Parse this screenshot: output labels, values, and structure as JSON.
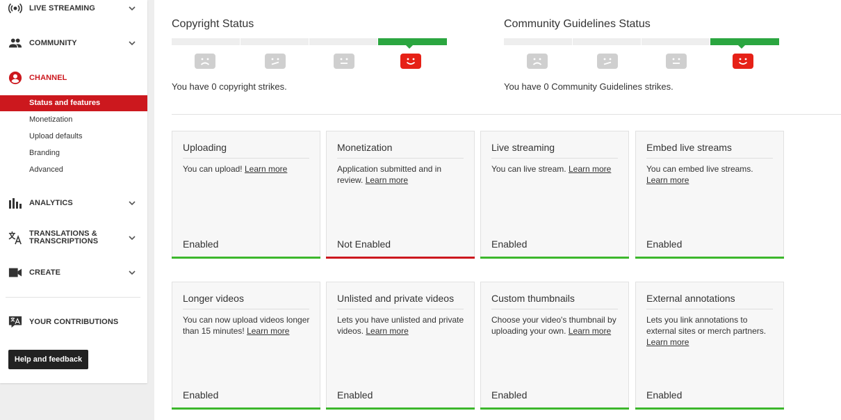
{
  "sidebar": {
    "sections": [
      {
        "id": "live-streaming",
        "label": "LIVE STREAMING",
        "icon": "live-icon"
      },
      {
        "id": "community",
        "label": "COMMUNITY",
        "icon": "people-icon"
      },
      {
        "id": "channel",
        "label": "CHANNEL",
        "icon": "account-icon"
      },
      {
        "id": "analytics",
        "label": "ANALYTICS",
        "icon": "bar-chart-icon"
      },
      {
        "id": "translations",
        "label": "TRANSLATIONS & TRANSCRIPTIONS",
        "icon": "translate-icon"
      },
      {
        "id": "create",
        "label": "CREATE",
        "icon": "video-camera-icon"
      }
    ],
    "channel_items": [
      "Status and features",
      "Monetization",
      "Upload defaults",
      "Branding",
      "Advanced"
    ],
    "contributions_label": "YOUR CONTRIBUTIONS",
    "help_button": "Help and feedback"
  },
  "status": {
    "copyright": {
      "title": "Copyright Status",
      "text": "You have 0 copyright strikes.",
      "strikes": 0
    },
    "community": {
      "title": "Community Guidelines Status",
      "text": "You have 0 Community Guidelines strikes.",
      "strikes": 0
    }
  },
  "features": [
    {
      "title": "Uploading",
      "desc": "You can upload!",
      "link": "Learn more",
      "status": "Enabled",
      "enabled": true
    },
    {
      "title": "Monetization",
      "desc": "Application submitted and in review.",
      "link": "Learn more",
      "status": "Not Enabled",
      "enabled": false
    },
    {
      "title": "Live streaming",
      "desc": "You can live stream.",
      "link": "Learn more",
      "status": "Enabled",
      "enabled": true
    },
    {
      "title": "Embed live streams",
      "desc": "You can embed live streams.",
      "link": "Learn more",
      "status": "Enabled",
      "enabled": true
    },
    {
      "title": "Longer videos",
      "desc": "You can now upload videos longer than 15 minutes!",
      "link": "Learn more",
      "status": "Enabled",
      "enabled": true
    },
    {
      "title": "Unlisted and private videos",
      "desc": "Lets you have unlisted and private videos.",
      "link": "Learn more",
      "status": "Enabled",
      "enabled": true
    },
    {
      "title": "Custom thumbnails",
      "desc": "Choose your video's thumbnail by uploading your own.",
      "link": "Learn more",
      "status": "Enabled",
      "enabled": true
    },
    {
      "title": "External annotations",
      "desc": "Lets you link annotations to external sites or merch partners.",
      "link": "Learn more",
      "status": "Enabled",
      "enabled": true
    }
  ],
  "colors": {
    "accent": "#cc181e",
    "enabled": "#3cb72c",
    "current_strike": "#2ba640",
    "happy_face": "#e62117"
  }
}
